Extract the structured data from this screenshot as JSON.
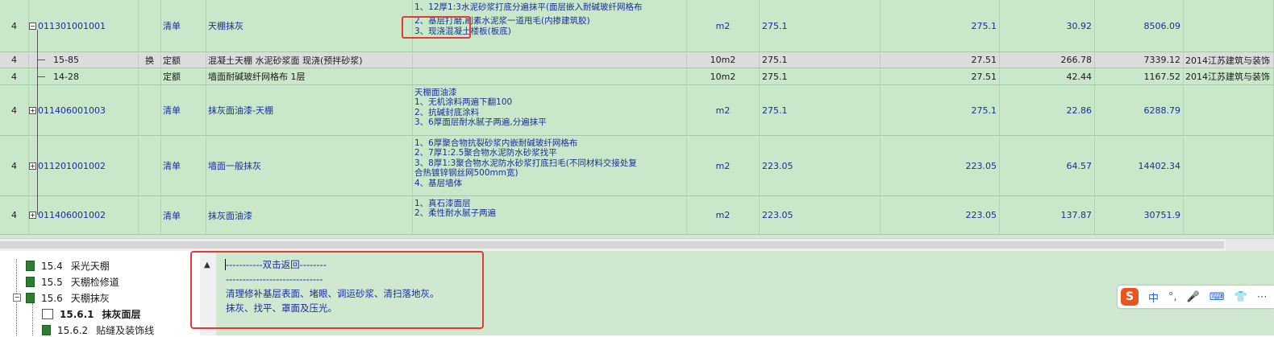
{
  "grid": {
    "rows": [
      {
        "num": "4",
        "code": "011301001001",
        "swap": "",
        "type": "清单",
        "name": "天棚抹灰",
        "features": [
          "1、12厚1:3水泥砂浆打底分遍抹平(面层嵌入耐碱玻纤网格布",
          "2、基层打磨,刷素水泥浆一道甩毛(内掺建筑胶)",
          "3、现浇混凝土楼板(板底)"
        ],
        "unit": "m2",
        "qty_expr": "275.1",
        "qty": "275.1",
        "price": "30.92",
        "total": "8506.09",
        "spec": ""
      },
      {
        "num": "4",
        "code": "15-85",
        "swap": "换",
        "type": "定额",
        "name": "混凝土天棚 水泥砂浆面 现浇(预拌砂浆)",
        "features": [],
        "unit": "10m2",
        "qty_expr": "275.1",
        "qty": "27.51",
        "price": "266.78",
        "total": "7339.12",
        "spec": "2014江苏建筑与装饰"
      },
      {
        "num": "4",
        "code": "14-28",
        "swap": "",
        "type": "定额",
        "name": "墙面耐碱玻纤网格布 1层",
        "features": [],
        "unit": "10m2",
        "qty_expr": "275.1",
        "qty": "27.51",
        "price": "42.44",
        "total": "1167.52",
        "spec": "2014江苏建筑与装饰"
      },
      {
        "num": "4",
        "code": "011406001003",
        "swap": "",
        "type": "清单",
        "name": "抹灰面油漆-天棚",
        "features": [
          "天棚面油漆",
          "1、无机涂料两遍下翻100",
          "2、抗碱封底涂料",
          "3、6厚面层耐水腻子两遍,分遍抹平"
        ],
        "unit": "m2",
        "qty_expr": "275.1",
        "qty": "275.1",
        "price": "22.86",
        "total": "6288.79",
        "spec": ""
      },
      {
        "num": "4",
        "code": "011201001002",
        "swap": "",
        "type": "清单",
        "name": "墙面一般抹灰",
        "features": [
          "1、6厚聚合物抗裂砂浆内嵌耐碱玻纤网格布",
          "2、7厚1:2.5聚合物水泥防水砂浆找平",
          "3、8厚1:3聚合物水泥防水砂浆打底扫毛(不同材料交接处复",
          "合热镀锌钢丝网500mm宽)",
          "4、基层墙体"
        ],
        "unit": "m2",
        "qty_expr": "223.05",
        "qty": "223.05",
        "price": "64.57",
        "total": "14402.34",
        "spec": ""
      },
      {
        "num": "4",
        "code": "011406001002",
        "swap": "",
        "type": "清单",
        "name": "抹灰面油漆",
        "features": [
          "1、真石漆面层",
          "2、柔性耐水腻子两遍"
        ],
        "unit": "m2",
        "qty_expr": "223.05",
        "qty": "223.05",
        "price": "137.87",
        "total": "30751.9",
        "spec": ""
      }
    ]
  },
  "tree": {
    "nodes": [
      {
        "num": "15.4",
        "label": "采光天棚"
      },
      {
        "num": "15.5",
        "label": "天棚检修道"
      },
      {
        "num": "15.6",
        "label": "天棚抹灰"
      },
      {
        "num": "15.6.1",
        "label": "抹灰面层"
      },
      {
        "num": "15.6.2",
        "label": "贴缝及装饰线"
      }
    ]
  },
  "note": {
    "line1": "-----------双击返回--------",
    "line2": "-----------------------------",
    "line3": "清理修补基层表面、堵眼、调运砂浆、清扫落地灰。",
    "line4": "抹灰、找平、罩面及压光。"
  },
  "ime": {
    "logo": "S",
    "items": [
      "中",
      "°,",
      "🎤",
      "⌨",
      "👕",
      "⋯"
    ]
  },
  "colors": {
    "grid_bg": "#c9e7c9",
    "highlight_red": "#e53935",
    "text_blue": "#1b2f9a"
  }
}
